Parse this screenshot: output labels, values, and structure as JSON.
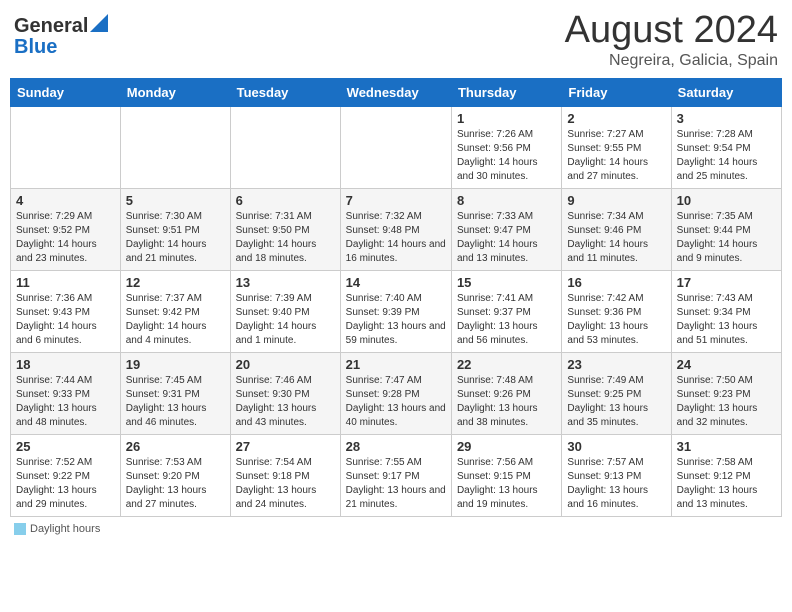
{
  "header": {
    "logo_general": "General",
    "logo_blue": "Blue",
    "month_title": "August 2024",
    "location": "Negreira, Galicia, Spain"
  },
  "days_of_week": [
    "Sunday",
    "Monday",
    "Tuesday",
    "Wednesday",
    "Thursday",
    "Friday",
    "Saturday"
  ],
  "weeks": [
    [
      {
        "day": "",
        "info": ""
      },
      {
        "day": "",
        "info": ""
      },
      {
        "day": "",
        "info": ""
      },
      {
        "day": "",
        "info": ""
      },
      {
        "day": "1",
        "info": "Sunrise: 7:26 AM\nSunset: 9:56 PM\nDaylight: 14 hours and 30 minutes."
      },
      {
        "day": "2",
        "info": "Sunrise: 7:27 AM\nSunset: 9:55 PM\nDaylight: 14 hours and 27 minutes."
      },
      {
        "day": "3",
        "info": "Sunrise: 7:28 AM\nSunset: 9:54 PM\nDaylight: 14 hours and 25 minutes."
      }
    ],
    [
      {
        "day": "4",
        "info": "Sunrise: 7:29 AM\nSunset: 9:52 PM\nDaylight: 14 hours and 23 minutes."
      },
      {
        "day": "5",
        "info": "Sunrise: 7:30 AM\nSunset: 9:51 PM\nDaylight: 14 hours and 21 minutes."
      },
      {
        "day": "6",
        "info": "Sunrise: 7:31 AM\nSunset: 9:50 PM\nDaylight: 14 hours and 18 minutes."
      },
      {
        "day": "7",
        "info": "Sunrise: 7:32 AM\nSunset: 9:48 PM\nDaylight: 14 hours and 16 minutes."
      },
      {
        "day": "8",
        "info": "Sunrise: 7:33 AM\nSunset: 9:47 PM\nDaylight: 14 hours and 13 minutes."
      },
      {
        "day": "9",
        "info": "Sunrise: 7:34 AM\nSunset: 9:46 PM\nDaylight: 14 hours and 11 minutes."
      },
      {
        "day": "10",
        "info": "Sunrise: 7:35 AM\nSunset: 9:44 PM\nDaylight: 14 hours and 9 minutes."
      }
    ],
    [
      {
        "day": "11",
        "info": "Sunrise: 7:36 AM\nSunset: 9:43 PM\nDaylight: 14 hours and 6 minutes."
      },
      {
        "day": "12",
        "info": "Sunrise: 7:37 AM\nSunset: 9:42 PM\nDaylight: 14 hours and 4 minutes."
      },
      {
        "day": "13",
        "info": "Sunrise: 7:39 AM\nSunset: 9:40 PM\nDaylight: 14 hours and 1 minute."
      },
      {
        "day": "14",
        "info": "Sunrise: 7:40 AM\nSunset: 9:39 PM\nDaylight: 13 hours and 59 minutes."
      },
      {
        "day": "15",
        "info": "Sunrise: 7:41 AM\nSunset: 9:37 PM\nDaylight: 13 hours and 56 minutes."
      },
      {
        "day": "16",
        "info": "Sunrise: 7:42 AM\nSunset: 9:36 PM\nDaylight: 13 hours and 53 minutes."
      },
      {
        "day": "17",
        "info": "Sunrise: 7:43 AM\nSunset: 9:34 PM\nDaylight: 13 hours and 51 minutes."
      }
    ],
    [
      {
        "day": "18",
        "info": "Sunrise: 7:44 AM\nSunset: 9:33 PM\nDaylight: 13 hours and 48 minutes."
      },
      {
        "day": "19",
        "info": "Sunrise: 7:45 AM\nSunset: 9:31 PM\nDaylight: 13 hours and 46 minutes."
      },
      {
        "day": "20",
        "info": "Sunrise: 7:46 AM\nSunset: 9:30 PM\nDaylight: 13 hours and 43 minutes."
      },
      {
        "day": "21",
        "info": "Sunrise: 7:47 AM\nSunset: 9:28 PM\nDaylight: 13 hours and 40 minutes."
      },
      {
        "day": "22",
        "info": "Sunrise: 7:48 AM\nSunset: 9:26 PM\nDaylight: 13 hours and 38 minutes."
      },
      {
        "day": "23",
        "info": "Sunrise: 7:49 AM\nSunset: 9:25 PM\nDaylight: 13 hours and 35 minutes."
      },
      {
        "day": "24",
        "info": "Sunrise: 7:50 AM\nSunset: 9:23 PM\nDaylight: 13 hours and 32 minutes."
      }
    ],
    [
      {
        "day": "25",
        "info": "Sunrise: 7:52 AM\nSunset: 9:22 PM\nDaylight: 13 hours and 29 minutes."
      },
      {
        "day": "26",
        "info": "Sunrise: 7:53 AM\nSunset: 9:20 PM\nDaylight: 13 hours and 27 minutes."
      },
      {
        "day": "27",
        "info": "Sunrise: 7:54 AM\nSunset: 9:18 PM\nDaylight: 13 hours and 24 minutes."
      },
      {
        "day": "28",
        "info": "Sunrise: 7:55 AM\nSunset: 9:17 PM\nDaylight: 13 hours and 21 minutes."
      },
      {
        "day": "29",
        "info": "Sunrise: 7:56 AM\nSunset: 9:15 PM\nDaylight: 13 hours and 19 minutes."
      },
      {
        "day": "30",
        "info": "Sunrise: 7:57 AM\nSunset: 9:13 PM\nDaylight: 13 hours and 16 minutes."
      },
      {
        "day": "31",
        "info": "Sunrise: 7:58 AM\nSunset: 9:12 PM\nDaylight: 13 hours and 13 minutes."
      }
    ]
  ],
  "footer": {
    "daylight_label": "Daylight hours"
  }
}
